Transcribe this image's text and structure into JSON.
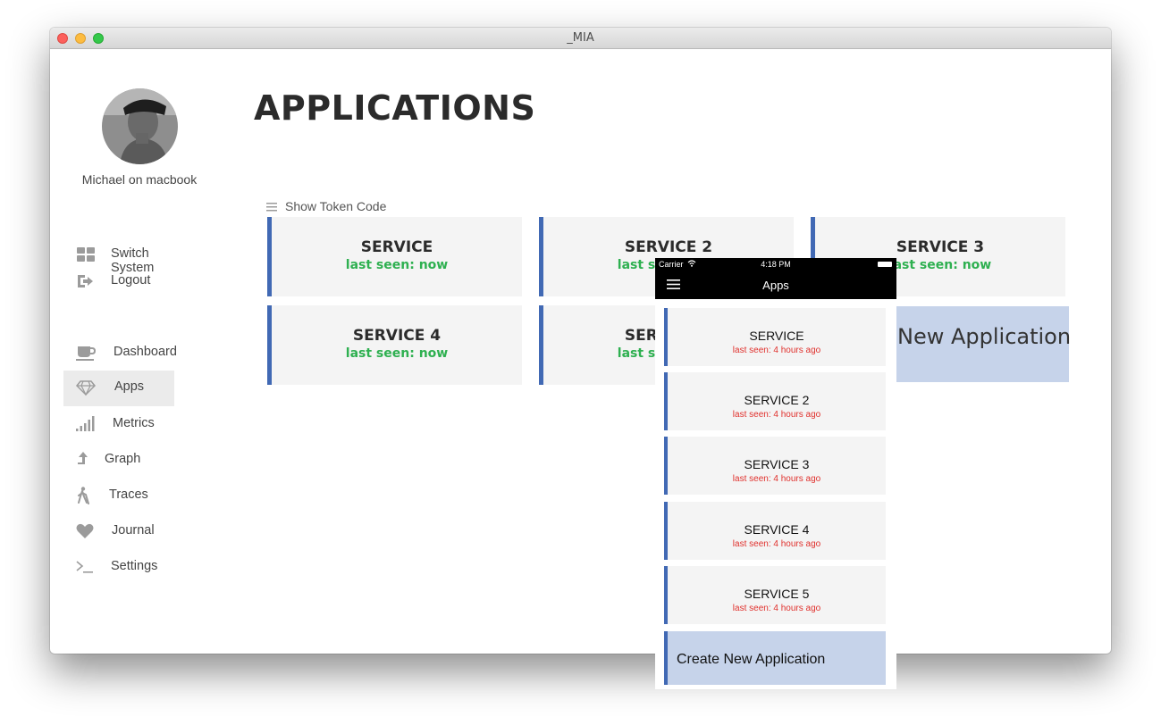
{
  "window": {
    "title": "_MIA"
  },
  "user": {
    "name": "Michael on macbook"
  },
  "sidebar": {
    "top_items": [
      {
        "label": "Switch System",
        "icon": "grid-icon"
      },
      {
        "label": "Logout",
        "icon": "logout-icon"
      }
    ],
    "items": [
      {
        "label": "Dashboard",
        "icon": "coffee-cup-icon"
      },
      {
        "label": "Apps",
        "icon": "diamond-icon",
        "active": true
      },
      {
        "label": "Metrics",
        "icon": "signal-bars-icon"
      },
      {
        "label": "Graph",
        "icon": "arrow-up-icon"
      },
      {
        "label": "Traces",
        "icon": "walking-person-icon"
      },
      {
        "label": "Journal",
        "icon": "heart-icon"
      },
      {
        "label": "Settings",
        "icon": "terminal-icon"
      }
    ]
  },
  "main": {
    "title": "APPLICATIONS",
    "token_toggle": "Show Token Code",
    "services": [
      {
        "name": "SERVICE",
        "status": "last seen: now"
      },
      {
        "name": "SERVICE 2",
        "status": "last seen: now"
      },
      {
        "name": "SERVICE 3",
        "status": "last seen: now"
      },
      {
        "name": "SERVICE 4",
        "status": "last seen: now"
      },
      {
        "name": "SERVICE 5",
        "status": "last seen: now"
      }
    ],
    "new_app_label": "New Application"
  },
  "phone": {
    "carrier": "Carrier",
    "time": "4:18 PM",
    "nav_title": "Apps",
    "services": [
      {
        "name": "SERVICE",
        "status": "last seen: 4 hours ago"
      },
      {
        "name": "SERVICE 2",
        "status": "last seen: 4 hours ago"
      },
      {
        "name": "SERVICE 3",
        "status": "last seen: 4 hours ago"
      },
      {
        "name": "SERVICE 4",
        "status": "last seen: 4 hours ago"
      },
      {
        "name": "SERVICE 5",
        "status": "last seen: 4 hours ago"
      }
    ],
    "create_label": "Create New Application"
  },
  "colors": {
    "accent": "#4169b4",
    "status_ok": "#2eb050",
    "status_stale": "#e0312d",
    "new_app_bg": "#c6d3ea"
  }
}
